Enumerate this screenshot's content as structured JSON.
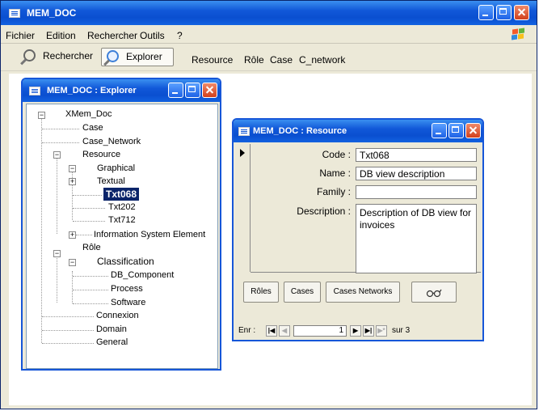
{
  "app": {
    "title": "MEM_DOC"
  },
  "menu": [
    "Fichier",
    "Edition",
    "Rechercher",
    "Outils",
    "?"
  ],
  "toolbar": {
    "search_label": "Rechercher",
    "explorer_label": "Explorer",
    "links": [
      "Resource",
      "Rôle",
      "Case",
      "C_network"
    ]
  },
  "explorer": {
    "title": "MEM_DOC : Explorer",
    "tree": {
      "root": "XMem_Doc",
      "case": "Case",
      "case_network": "Case_Network",
      "resource": "Resource",
      "graphical": "Graphical",
      "textual": "Textual",
      "txt068": "Txt068",
      "txt202": "Txt202",
      "txt712": "Txt712",
      "ise": "Information System Element",
      "role": "Rôle",
      "classification": "Classification",
      "db_component": "DB_Component",
      "process": "Process",
      "software": "Software",
      "connexion": "Connexion",
      "domain": "Domain",
      "general": "General"
    }
  },
  "resource": {
    "title": "MEM_DOC : Resource",
    "labels": {
      "code": "Code :",
      "name": "Name :",
      "family": "Family :",
      "description": "Description :"
    },
    "values": {
      "code": "Txt068",
      "name": "DB view description",
      "family": "",
      "description": "Description of DB view for invoices"
    },
    "buttons": {
      "roles": "Rôles",
      "cases": "Cases",
      "cases_networks": "Cases Networks"
    },
    "nav": {
      "label": "Enr :",
      "current": "1",
      "total_label": "sur 3"
    }
  }
}
